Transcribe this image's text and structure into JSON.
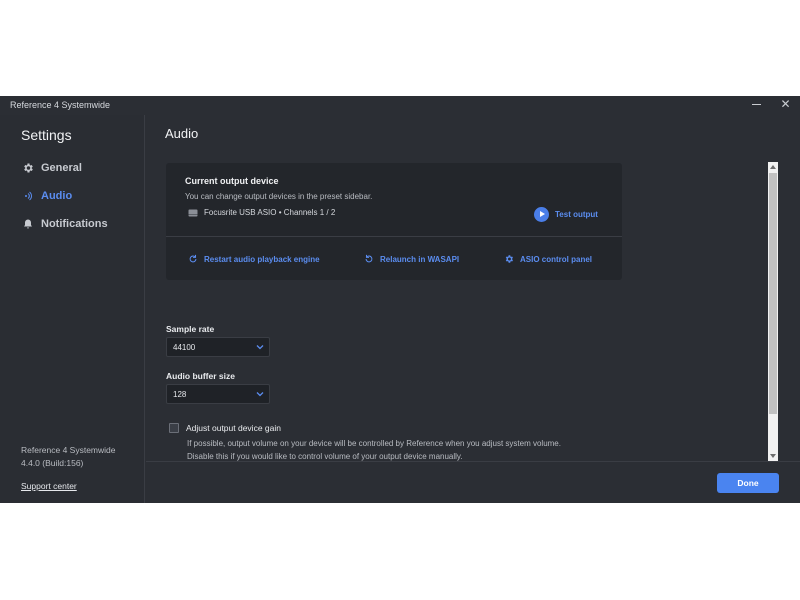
{
  "window": {
    "title": "Reference 4 Systemwide"
  },
  "sidebar": {
    "heading": "Settings",
    "items": [
      {
        "label": "General",
        "icon": "gear-icon",
        "active": false
      },
      {
        "label": "Audio",
        "icon": "audio-wave-icon",
        "active": true
      },
      {
        "label": "Notifications",
        "icon": "bell-icon",
        "active": false
      }
    ],
    "app_name": "Reference 4 Systemwide",
    "app_version": "4.4.0 (Build:156)",
    "support_link": "Support center"
  },
  "main": {
    "title": "Audio",
    "output_card": {
      "title": "Current output device",
      "description": "You can change output devices in the preset sidebar.",
      "device": "Focusrite USB ASIO • Channels 1 / 2",
      "test_label": "Test output",
      "actions": [
        {
          "label": "Restart audio playback engine",
          "icon": "refresh-icon"
        },
        {
          "label": "Relaunch in WASAPI",
          "icon": "undo-icon"
        },
        {
          "label": "ASIO control panel",
          "icon": "gear-icon"
        }
      ]
    },
    "sample_rate": {
      "label": "Sample rate",
      "value": "44100"
    },
    "buffer_size": {
      "label": "Audio buffer size",
      "value": "128"
    },
    "gain": {
      "label": "Adjust output device gain",
      "checked": false,
      "description_line1": "If possible, output volume on your device will be controlled by Reference when you adjust system volume.",
      "description_line2": "Disable this if you would like to control volume of your output device manually."
    },
    "done_label": "Done"
  },
  "colors": {
    "accent": "#5b8df0",
    "button": "#4a84f0",
    "background": "#2b2e34",
    "card": "#23262b"
  }
}
